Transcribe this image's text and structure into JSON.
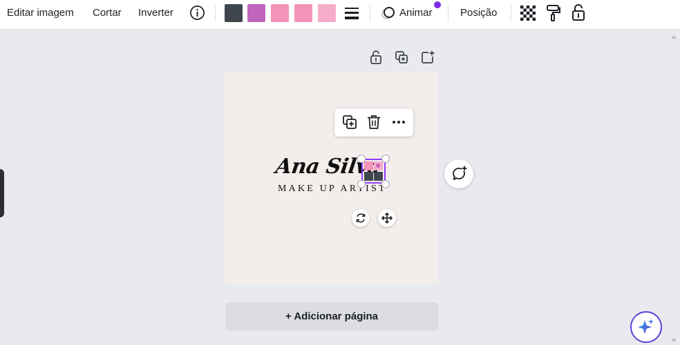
{
  "toolbar": {
    "edit_image": "Editar imagem",
    "crop": "Cortar",
    "flip": "Inverter",
    "info_icon": "info-icon",
    "swatches": [
      "#40464d",
      "#c164be",
      "#f393b7",
      "#f393b7",
      "#f5adc9"
    ],
    "line_style_icon": "line-weight-icon",
    "animate": "Animar",
    "animate_badge_color": "#7d2ae8",
    "position": "Posição",
    "transparency_icon": "checkerboard-icon",
    "paint_icon": "paint-roller-icon",
    "lock_icon": "unlock-icon"
  },
  "canvas": {
    "page_bg": "#f3eeeb",
    "page_actions": [
      "unlock-icon",
      "duplicate-page-icon",
      "add-page-icon"
    ],
    "floating_menu": [
      "duplicate-icon",
      "trash-icon",
      "more-icon"
    ],
    "logo": {
      "name": "Ana Silva",
      "subtitle": "MAKE UP ARTIST"
    },
    "controls": [
      "rotate-icon",
      "move-icon"
    ],
    "comment_icon": "add-comment-icon",
    "add_page": "+ Adicionar página"
  },
  "accent": "#8b3dff",
  "magic_icon": "sparkle-icon"
}
